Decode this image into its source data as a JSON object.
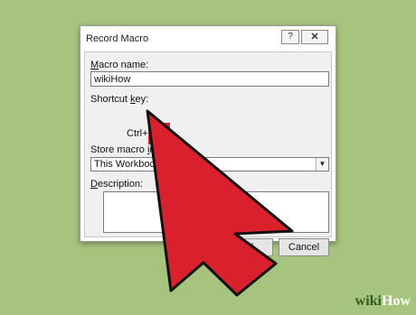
{
  "dialog": {
    "title": "Record Macro",
    "help_icon": "?",
    "close_icon": "✕",
    "macro_name_label_pre": "",
    "macro_name_label_ul": "M",
    "macro_name_label_post": "acro name:",
    "macro_name_value": "wikiHow",
    "shortcut_label_pre": "Shortcut ",
    "shortcut_label_ul": "k",
    "shortcut_label_post": "ey:",
    "ctrl_label": "Ctrl+",
    "store_label_pre": "Store macro ",
    "store_label_ul": "i",
    "store_label_post": "n:",
    "store_value": "This Workbook",
    "description_label_pre": "",
    "description_label_ul": "D",
    "description_label_post": "escription:",
    "ok_label": "OK",
    "cancel_label": "Cancel"
  },
  "annotation": {
    "highlight_color": "#d9202c",
    "arrow_color": "#d9202c"
  },
  "watermark": {
    "part1": "wiki",
    "part2": "How"
  }
}
